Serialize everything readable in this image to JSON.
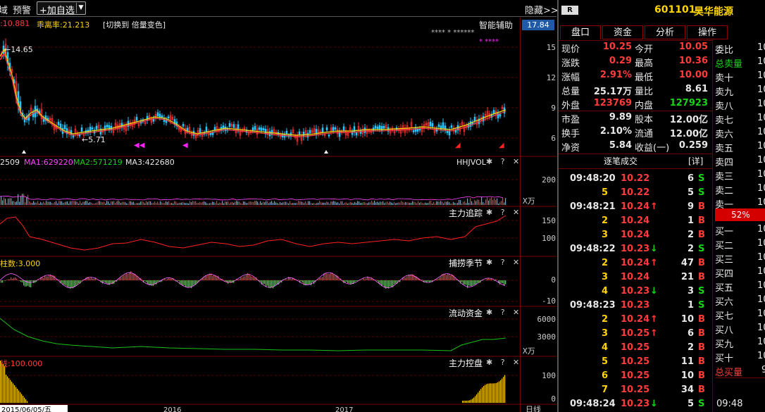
{
  "toolbar": {
    "left_cut": "域",
    "alert": "预警",
    "add_watch": "+加自选",
    "hide": "隐藏>>"
  },
  "main_panel": {
    "price_label": ":10.881",
    "ratio_label": "乖离率:21.213",
    "switch_hint": "[切换到 倍量变色]",
    "assist": "智能辅助",
    "assist_stars1": "****  * ******",
    "assist_stars2": "* ****",
    "current_price_tag": "17.84",
    "high_mark": "←14.65",
    "low_mark": "←5.71",
    "y_ticks": [
      "15",
      "12",
      "9",
      "6"
    ]
  },
  "vol_panel": {
    "vol": "2509",
    "ma1": "MA1:629220",
    "ma2": "MA2:571219",
    "ma3": "MA3:422680",
    "title": "HHJVOL",
    "tick": "200",
    "unit": "X万"
  },
  "track_panel": {
    "title": "主力追踪",
    "ticks": [
      "150",
      "100"
    ]
  },
  "season_panel": {
    "label": "柱数:3.000",
    "title": "捕捞季节",
    "ticks": [
      "0",
      "-10"
    ]
  },
  "flow_panel": {
    "title": "流动资金",
    "ticks": [
      "6000",
      "3000"
    ],
    "unit": "X万"
  },
  "control_panel": {
    "label": "线:100.000",
    "title": "主力控盘",
    "ticks": [
      "100",
      "0"
    ]
  },
  "panel_icons": "✱ ? ✕",
  "bottom_axis": [
    "2015/06/05/五",
    "2016",
    "2017"
  ],
  "bottom_right": "日线",
  "stock": {
    "badge": "R",
    "code": "601101",
    "name": "昊华能源"
  },
  "tabs": [
    "盘口",
    "资金",
    "分析",
    "操作"
  ],
  "quote": [
    {
      "l1": "现价",
      "v1": "10.25",
      "c1": "red",
      "l2": "今开",
      "v2": "10.05",
      "c2": "red"
    },
    {
      "l1": "涨跌",
      "v1": "0.29",
      "c1": "red",
      "l2": "最高",
      "v2": "10.36",
      "c2": "red"
    },
    {
      "l1": "涨幅",
      "v1": "2.91%",
      "c1": "red",
      "l2": "最低",
      "v2": "10.00",
      "c2": "red"
    },
    {
      "l1": "总量",
      "v1": "25.17万",
      "c1": "wht",
      "l2": "量比",
      "v2": "8.61",
      "c2": "wht"
    },
    {
      "l1": "外盘",
      "v1": "123769",
      "c1": "red",
      "l2": "内盘",
      "v2": "127923",
      "c2": "grn"
    },
    {
      "l1": "市盈",
      "v1": "9.89",
      "c1": "wht",
      "l2": "股本",
      "v2": "12.00亿",
      "c2": "wht"
    },
    {
      "l1": "换手",
      "v1": "2.10%",
      "c1": "wht",
      "l2": "流通",
      "v2": "12.00亿",
      "c2": "wht"
    },
    {
      "l1": "净资",
      "v1": "5.84",
      "c1": "wht",
      "l2": "收益(一)",
      "v2": "0.259",
      "c2": "wht"
    }
  ],
  "trades_header": {
    "title": "逐笔成交",
    "detail": "[详]"
  },
  "trades": [
    {
      "time": "09:48:20",
      "price": "10.22",
      "arrow": "",
      "vol": "6",
      "side": "S"
    },
    {
      "time": "",
      "price": "10.22",
      "arrow": "",
      "vol": "5",
      "side": "S",
      "n": "5"
    },
    {
      "time": "09:48:21",
      "price": "10.24",
      "arrow": "↑",
      "vol": "9",
      "side": "B"
    },
    {
      "time": "",
      "price": "10.24",
      "arrow": "",
      "vol": "1",
      "side": "B",
      "n": "2"
    },
    {
      "time": "",
      "price": "10.24",
      "arrow": "",
      "vol": "2",
      "side": "B",
      "n": "3"
    },
    {
      "time": "09:48:22",
      "price": "10.23",
      "arrow": "↓",
      "vol": "2",
      "side": "S"
    },
    {
      "time": "",
      "price": "10.24",
      "arrow": "↑",
      "vol": "47",
      "side": "B",
      "n": "2"
    },
    {
      "time": "",
      "price": "10.24",
      "arrow": "",
      "vol": "21",
      "side": "B",
      "n": "3"
    },
    {
      "time": "",
      "price": "10.23",
      "arrow": "↓",
      "vol": "3",
      "side": "S",
      "n": "4"
    },
    {
      "time": "09:48:23",
      "price": "10.23",
      "arrow": "",
      "vol": "1",
      "side": "S"
    },
    {
      "time": "",
      "price": "10.24",
      "arrow": "↑",
      "vol": "10",
      "side": "B",
      "n": "2"
    },
    {
      "time": "",
      "price": "10.25",
      "arrow": "↑",
      "vol": "6",
      "side": "B",
      "n": "3"
    },
    {
      "time": "",
      "price": "10.25",
      "arrow": "",
      "vol": "2",
      "side": "B",
      "n": "4"
    },
    {
      "time": "",
      "price": "10.25",
      "arrow": "",
      "vol": "11",
      "side": "B",
      "n": "5"
    },
    {
      "time": "",
      "price": "10.25",
      "arrow": "",
      "vol": "10",
      "side": "B",
      "n": "6"
    },
    {
      "time": "",
      "price": "10.25",
      "arrow": "",
      "vol": "34",
      "side": "B",
      "n": "7"
    },
    {
      "time": "09:48:24",
      "price": "10.23",
      "arrow": "↓",
      "vol": "5",
      "side": "S"
    }
  ],
  "orderbook": {
    "wei_bi": "委比",
    "total_sell": "总卖量",
    "sells": [
      "卖十",
      "卖九",
      "卖八",
      "卖七",
      "卖六",
      "卖五",
      "卖四",
      "卖三",
      "卖二",
      "卖一"
    ],
    "ratio": "52%",
    "buys": [
      "买一",
      "买二",
      "买三",
      "买四",
      "买五",
      "买六",
      "买七",
      "买八",
      "买九",
      "买十"
    ],
    "total_buy": "总买量",
    "cut_value": "10",
    "cut_total": "9",
    "time": "09:48"
  }
}
